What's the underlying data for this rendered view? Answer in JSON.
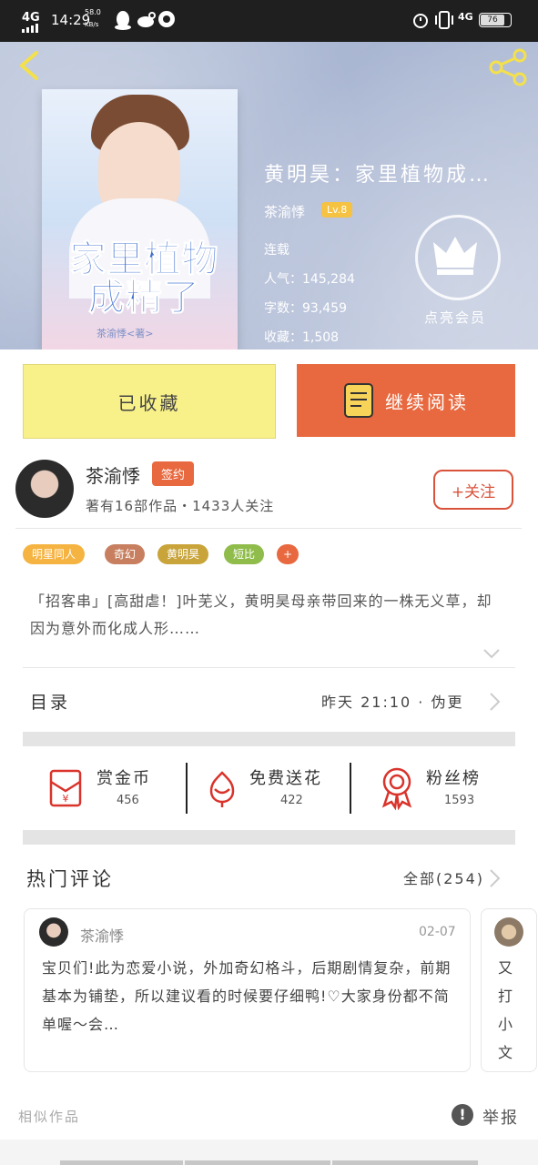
{
  "status_bar": {
    "network": "4G",
    "time": "14:29",
    "speed": "58.0",
    "speed_unit": "KB/s",
    "network_right": "4G",
    "battery": "76"
  },
  "book": {
    "title": "黄明昊：家里植物成…",
    "cover_title_line1": "家里植物",
    "cover_title_line2": "成精了",
    "cover_author": "茶渝悸<著>",
    "author": "茶渝悸",
    "level": "Lv.8",
    "status": "连载",
    "popularity_label": "人气：",
    "popularity": "145,284",
    "words_label": "字数：",
    "words": "93,459",
    "favorites_label": "收藏：",
    "favorites": "1,508",
    "vip_label": "点亮会员"
  },
  "actions": {
    "fav_label": "已收藏",
    "read_label": "继续阅读"
  },
  "author_info": {
    "name": "茶渝悸",
    "badge": "签约",
    "works": "著有16部作品・1433人关注",
    "follow_label": "+关注"
  },
  "tags": [
    {
      "label": "明星同人",
      "color": "#f5b342"
    },
    {
      "label": "奇幻",
      "color": "#c77f5f"
    },
    {
      "label": "黄明昊",
      "color": "#c9a43a"
    },
    {
      "label": "短比",
      "color": "#8fbc4a"
    },
    {
      "label": "+",
      "color": "#e8693f"
    }
  ],
  "description": "「招客串」[高甜虐！]叶芜义，黄明昊母亲带回来的一株无义草，却因为意外而化成人形……",
  "toc": {
    "label": "目录",
    "update": "昨天 21:10 · 伪更"
  },
  "stats": [
    {
      "label": "赏金币",
      "value": "456",
      "icon": "red-envelope-icon"
    },
    {
      "label": "免费送花",
      "value": "422",
      "icon": "flower-icon"
    },
    {
      "label": "粉丝榜",
      "value": "1593",
      "icon": "medal-icon"
    }
  ],
  "comments": {
    "title": "热门评论",
    "all_label": "全部(254)",
    "items": [
      {
        "user": "茶渝悸",
        "date": "02-07",
        "text": "宝贝们!此为恋爱小说，外加奇幻格斗，后期剧情复杂，前期基本为铺垫，所以建议看的时候要仔细鸭!♡大家身份都不简单喔～会…"
      }
    ],
    "second_preview": [
      "又",
      "打",
      "小",
      "文"
    ]
  },
  "footer": {
    "similar_label": "相似作品",
    "report_label": "举报"
  },
  "colors": {
    "accent": "#e8693f",
    "fav_bg": "#f8f18a",
    "follow": "#d9533b"
  }
}
